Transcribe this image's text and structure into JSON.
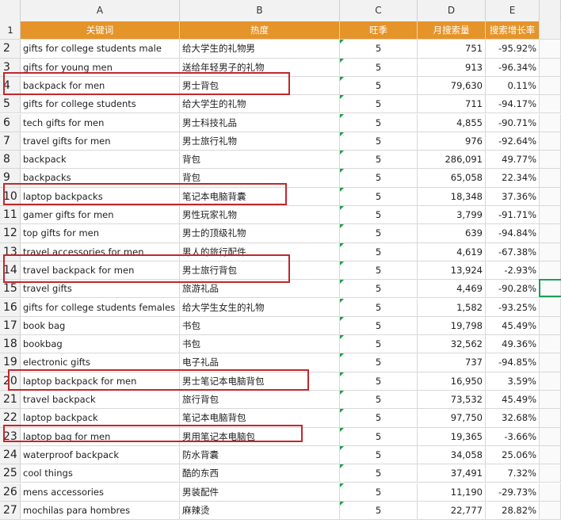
{
  "columns": [
    "A",
    "B",
    "C",
    "D",
    "E"
  ],
  "header": {
    "row_number": "1",
    "keyword": "关键词",
    "heat": "热度",
    "season": "旺季",
    "monthly_search": "月搜索量",
    "growth": "搜索增长率"
  },
  "rows": [
    {
      "n": "2",
      "kw": "gifts for college students male",
      "zh": "给大学生的礼物男",
      "season": "5",
      "vol": "751",
      "growth": "-95.92%"
    },
    {
      "n": "3",
      "kw": "gifts for young men",
      "zh": "送给年轻男子的礼物",
      "season": "5",
      "vol": "913",
      "growth": "-96.34%"
    },
    {
      "n": "4",
      "kw": "backpack for men",
      "zh": "男士背包",
      "season": "5",
      "vol": "79,630",
      "growth": "0.11%"
    },
    {
      "n": "5",
      "kw": "gifts for college students",
      "zh": "给大学生的礼物",
      "season": "5",
      "vol": "711",
      "growth": "-94.17%"
    },
    {
      "n": "6",
      "kw": "tech gifts for men",
      "zh": "男士科技礼品",
      "season": "5",
      "vol": "4,855",
      "growth": "-90.71%"
    },
    {
      "n": "7",
      "kw": "travel gifts for men",
      "zh": "男士旅行礼物",
      "season": "5",
      "vol": "976",
      "growth": "-92.64%"
    },
    {
      "n": "8",
      "kw": "backpack",
      "zh": "背包",
      "season": "5",
      "vol": "286,091",
      "growth": "49.77%"
    },
    {
      "n": "9",
      "kw": "backpacks",
      "zh": "背包",
      "season": "5",
      "vol": "65,058",
      "growth": "22.34%"
    },
    {
      "n": "10",
      "kw": "laptop backpacks",
      "zh": "笔记本电脑背囊",
      "season": "5",
      "vol": "18,348",
      "growth": "37.36%"
    },
    {
      "n": "11",
      "kw": "gamer gifts for men",
      "zh": "男性玩家礼物",
      "season": "5",
      "vol": "3,799",
      "growth": "-91.71%"
    },
    {
      "n": "12",
      "kw": "top gifts for men",
      "zh": "男士的顶级礼物",
      "season": "5",
      "vol": "639",
      "growth": "-94.84%"
    },
    {
      "n": "13",
      "kw": "travel accessories for men",
      "zh": "男人的旅行配件",
      "season": "5",
      "vol": "4,619",
      "growth": "-67.38%"
    },
    {
      "n": "14",
      "kw": "travel backpack for men",
      "zh": "男士旅行背包",
      "season": "5",
      "vol": "13,924",
      "growth": "-2.93%"
    },
    {
      "n": "15",
      "kw": "travel gifts",
      "zh": "旅游礼品",
      "season": "5",
      "vol": "4,469",
      "growth": "-90.28%"
    },
    {
      "n": "16",
      "kw": "gifts for college students females",
      "zh": "给大学生女生的礼物",
      "season": "5",
      "vol": "1,582",
      "growth": "-93.25%"
    },
    {
      "n": "17",
      "kw": "book bag",
      "zh": "书包",
      "season": "5",
      "vol": "19,798",
      "growth": "45.49%"
    },
    {
      "n": "18",
      "kw": "bookbag",
      "zh": "书包",
      "season": "5",
      "vol": "32,562",
      "growth": "49.36%"
    },
    {
      "n": "19",
      "kw": "electronic gifts",
      "zh": "电子礼品",
      "season": "5",
      "vol": "737",
      "growth": "-94.85%"
    },
    {
      "n": "20",
      "kw": "laptop backpack for men",
      "zh": "男士笔记本电脑背包",
      "season": "5",
      "vol": "16,950",
      "growth": "3.59%"
    },
    {
      "n": "21",
      "kw": "travel backpack",
      "zh": "旅行背包",
      "season": "5",
      "vol": "73,532",
      "growth": "45.49%"
    },
    {
      "n": "22",
      "kw": "laptop backpack",
      "zh": "笔记本电脑背包",
      "season": "5",
      "vol": "97,750",
      "growth": "32.68%"
    },
    {
      "n": "23",
      "kw": "laptop bag for men",
      "zh": "男用笔记本电脑包",
      "season": "5",
      "vol": "19,365",
      "growth": "-3.66%"
    },
    {
      "n": "24",
      "kw": "waterproof backpack",
      "zh": "防水背囊",
      "season": "5",
      "vol": "34,058",
      "growth": "25.06%"
    },
    {
      "n": "25",
      "kw": "cool things",
      "zh": "酷的东西",
      "season": "5",
      "vol": "37,491",
      "growth": "7.32%"
    },
    {
      "n": "26",
      "kw": "mens accessories",
      "zh": "男装配件",
      "season": "5",
      "vol": "11,190",
      "growth": "-29.73%"
    },
    {
      "n": "27",
      "kw": "mochilas para hombres",
      "zh": "麻辣烫",
      "season": "5",
      "vol": "22,777",
      "growth": "28.82%"
    }
  ],
  "highlighted_rows": [
    "4",
    "10",
    "14",
    "20",
    "23"
  ],
  "colors": {
    "header_bg": "#e5942a",
    "highlight_border": "#c0282d",
    "selection_border": "#1d9f5a"
  }
}
